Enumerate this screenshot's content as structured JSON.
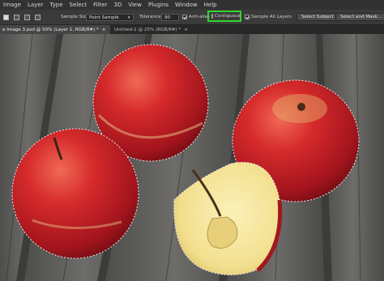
{
  "menu": [
    "Image",
    "Layer",
    "Type",
    "Select",
    "Filter",
    "3D",
    "View",
    "Plugins",
    "Window",
    "Help"
  ],
  "options": {
    "sample_size_label": "Sample Size:",
    "sample_size_value": "Point Sample",
    "tolerance_label": "Tolerance:",
    "tolerance_value": "90",
    "anti_alias_label": "Anti-alias",
    "anti_alias_checked": true,
    "contiguous_label": "Contiguous",
    "contiguous_checked": false,
    "sample_all_layers_label": "Sample All Layers",
    "sample_all_layers_checked": true,
    "select_subject_label": "Select Subject",
    "select_and_mask_label": "Select and Mask...",
    "highlight_color": "#2fd62f"
  },
  "tabs": [
    {
      "label": "e Image 3.psd @ 50% (Layer 1, RGB/8#) *",
      "close": "×",
      "active": true
    },
    {
      "label": "Untitled-2 @ 25% (RGB/8#) *",
      "close": "×",
      "active": false
    }
  ],
  "canvas": {
    "description_colors": {
      "wood": "#5a5a58",
      "apple_red": "#c8202a",
      "apple_flesh": "#f3e49a"
    }
  }
}
